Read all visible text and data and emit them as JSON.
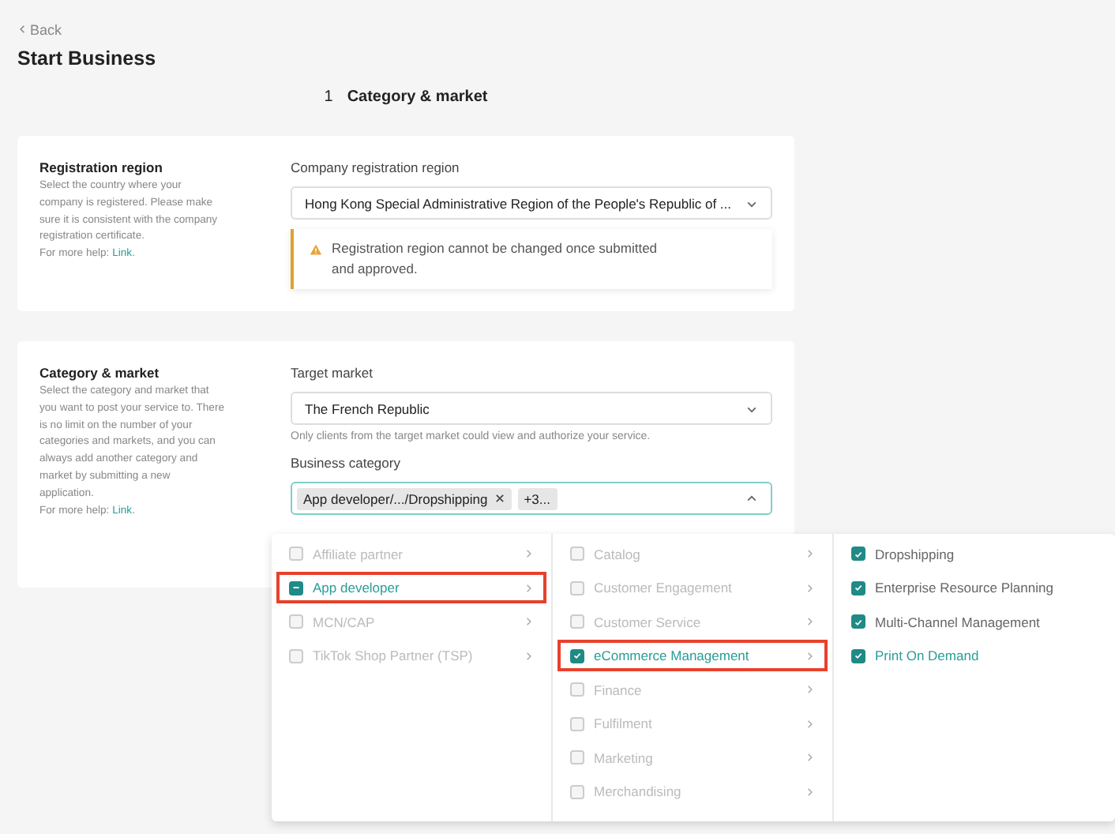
{
  "header": {
    "back": "Back",
    "title": "Start Business",
    "step": {
      "number": "1",
      "label": "Category & market"
    }
  },
  "sections": [
    {
      "title": "Registration region",
      "description": "Select the country where your company is registered. Please make sure it is consistent with the company registration certificate.",
      "help": "For more help: ",
      "help_link": "Link",
      "help_end": ".",
      "fields": [
        {
          "kind": "select",
          "label": "Company registration region",
          "value": "Hong Kong Special Administrative Region of the People's Republic of ...",
          "open": false
        },
        {
          "kind": "warning",
          "text": "Registration region cannot be changed once submitted and approved."
        }
      ]
    },
    {
      "title": "Category & market",
      "description": "Select the category and market that you want to post your service to. There is no limit on the number of your categories and markets, and you can always add another category and market by submitting a new application.",
      "help": "For more help: ",
      "help_link": "Link",
      "help_end": ".",
      "fields": [
        {
          "kind": "select",
          "label": "Target market",
          "value": "The French Republic",
          "open": false
        },
        {
          "kind": "hint",
          "text": "Only clients from the target market could view and authorize your service."
        },
        {
          "kind": "tags",
          "label": "Business category",
          "tags": [
            "App developer/.../Dropshipping"
          ],
          "more": "+3...",
          "open": true
        }
      ]
    }
  ],
  "cascader": [
    [
      {
        "label": "Affiliate partner",
        "checked": false,
        "indeterminate": false,
        "disabled": true,
        "active": false,
        "highlighted": false,
        "has_children": true
      },
      {
        "label": "App developer",
        "checked": true,
        "indeterminate": true,
        "disabled": false,
        "active": true,
        "highlighted": true,
        "has_children": true
      },
      {
        "label": "MCN/CAP",
        "checked": false,
        "indeterminate": false,
        "disabled": true,
        "active": false,
        "highlighted": false,
        "has_children": true
      },
      {
        "label": "TikTok Shop Partner (TSP)",
        "checked": false,
        "indeterminate": false,
        "disabled": true,
        "active": false,
        "highlighted": false,
        "has_children": true
      }
    ],
    [
      {
        "label": "Catalog",
        "checked": false,
        "indeterminate": false,
        "disabled": true,
        "active": false,
        "highlighted": false,
        "has_children": true
      },
      {
        "label": "Customer Engagement",
        "checked": false,
        "indeterminate": false,
        "disabled": true,
        "active": false,
        "highlighted": false,
        "has_children": true
      },
      {
        "label": "Customer Service",
        "checked": false,
        "indeterminate": false,
        "disabled": true,
        "active": false,
        "highlighted": false,
        "has_children": true
      },
      {
        "label": "eCommerce Management",
        "checked": true,
        "indeterminate": false,
        "disabled": false,
        "active": true,
        "highlighted": true,
        "has_children": true
      },
      {
        "label": "Finance",
        "checked": false,
        "indeterminate": false,
        "disabled": true,
        "active": false,
        "highlighted": false,
        "has_children": true
      },
      {
        "label": "Fulfilment",
        "checked": false,
        "indeterminate": false,
        "disabled": true,
        "active": false,
        "highlighted": false,
        "has_children": true
      },
      {
        "label": "Marketing",
        "checked": false,
        "indeterminate": false,
        "disabled": true,
        "active": false,
        "highlighted": false,
        "has_children": true
      },
      {
        "label": "Merchandising",
        "checked": false,
        "indeterminate": false,
        "disabled": true,
        "active": false,
        "highlighted": false,
        "has_children": true
      }
    ],
    [
      {
        "label": "Dropshipping",
        "checked": true,
        "indeterminate": false,
        "disabled": false,
        "active": false,
        "highlighted": false,
        "has_children": false
      },
      {
        "label": "Enterprise Resource Planning",
        "checked": true,
        "indeterminate": false,
        "disabled": false,
        "active": false,
        "highlighted": false,
        "has_children": false
      },
      {
        "label": "Multi-Channel Management",
        "checked": true,
        "indeterminate": false,
        "disabled": false,
        "active": false,
        "highlighted": false,
        "has_children": false
      },
      {
        "label": "Print On Demand",
        "checked": true,
        "indeterminate": false,
        "disabled": false,
        "active": true,
        "highlighted": false,
        "has_children": false
      }
    ]
  ]
}
